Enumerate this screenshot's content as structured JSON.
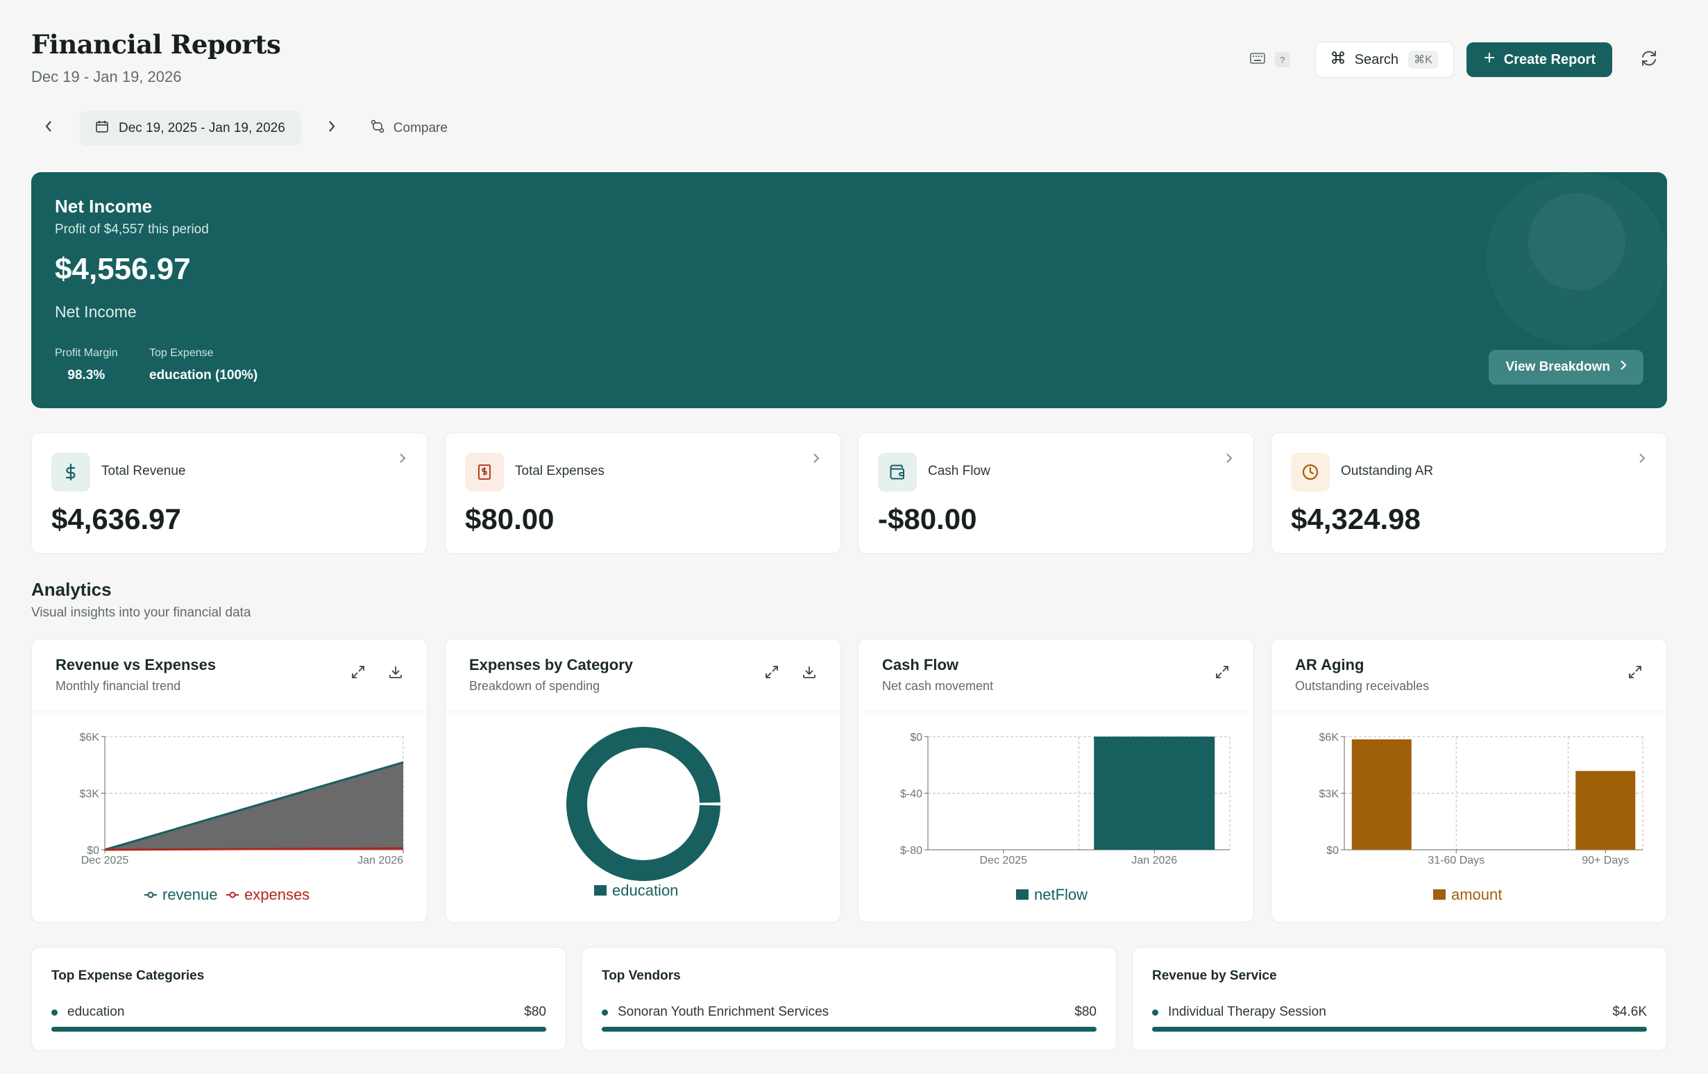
{
  "header": {
    "title": "Financial Reports",
    "subtitle": "Dec 19 - Jan 19, 2026",
    "shortcut_hint": "?",
    "search_label": "Search",
    "search_shortcut": "⌘K",
    "create_label": "Create Report"
  },
  "date_nav": {
    "range": "Dec 19, 2025 - Jan 19, 2026",
    "compare_label": "Compare"
  },
  "hero": {
    "label": "Net Income",
    "subtitle": "Profit of $4,557 this period",
    "value": "$4,556.97",
    "caption": "Net Income",
    "metrics": [
      {
        "label": "Profit Margin",
        "value": "98.3%"
      },
      {
        "label": "Top Expense",
        "value": "education (100%)"
      }
    ],
    "breakdown_label": "View Breakdown"
  },
  "kpis": [
    {
      "label": "Total Revenue",
      "value": "$4,636.97",
      "icon": "dollar-icon",
      "color": "#17605f",
      "bg": "#e5f0ef"
    },
    {
      "label": "Total Expenses",
      "value": "$80.00",
      "icon": "receipt-icon",
      "color": "#b3421f",
      "bg": "#fbece6"
    },
    {
      "label": "Cash Flow",
      "value": "-$80.00",
      "icon": "wallet-icon",
      "color": "#17605f",
      "bg": "#e5f0ef"
    },
    {
      "label": "Outstanding AR",
      "value": "$4,324.98",
      "icon": "clock-icon",
      "color": "#a0600a",
      "bg": "#fbf0e2"
    }
  ],
  "analytics": {
    "title": "Analytics",
    "subtitle": "Visual insights into your financial data"
  },
  "charts": [
    {
      "title": "Revenue vs Expenses",
      "subtitle": "Monthly financial trend"
    },
    {
      "title": "Expenses by Category",
      "subtitle": "Breakdown of spending"
    },
    {
      "title": "Cash Flow",
      "subtitle": "Net cash movement"
    },
    {
      "title": "AR Aging",
      "subtitle": "Outstanding receivables"
    }
  ],
  "chart_data": [
    {
      "type": "area",
      "x": [
        "Dec 2025",
        "Jan 2026"
      ],
      "series": [
        {
          "name": "revenue",
          "values": [
            0,
            4636.97
          ],
          "color": "#17605f"
        },
        {
          "name": "expenses",
          "values": [
            0,
            80
          ],
          "color": "#b3261e"
        }
      ],
      "yticks": [
        "$6K",
        "$3K",
        "$0"
      ],
      "ylim": [
        0,
        6000
      ],
      "grid": true,
      "legend": "bottom"
    },
    {
      "type": "pie",
      "categories": [
        "education"
      ],
      "values": [
        80
      ],
      "color": "#17605f",
      "legend": "bottom"
    },
    {
      "type": "bar",
      "categories": [
        "Dec 2025",
        "Jan 2026"
      ],
      "series": [
        {
          "name": "netFlow",
          "values": [
            0,
            -80
          ],
          "color": "#17605f"
        }
      ],
      "yticks": [
        "$0",
        "$-40",
        "$-80"
      ],
      "ylim": [
        -80,
        0
      ],
      "grid": true,
      "legend": "bottom"
    },
    {
      "type": "bar",
      "categories": [
        "",
        "31-60 Days",
        "",
        "90+ Days"
      ],
      "series": [
        {
          "name": "amount",
          "values": [
            6000,
            0,
            0,
            4324.98
          ],
          "color": "#a0600a"
        }
      ],
      "yticks": [
        "$6K",
        "$3K",
        "$0"
      ],
      "ylim": [
        0,
        6000
      ],
      "grid": true,
      "legend": "bottom"
    }
  ],
  "lists": [
    {
      "title": "Top Expense Categories",
      "name": "education",
      "value": "$80",
      "fill": 1.0
    },
    {
      "title": "Top Vendors",
      "name": "Sonoran Youth Enrichment Services",
      "value": "$80",
      "fill": 1.0
    },
    {
      "title": "Revenue by Service",
      "name": "Individual Therapy Session",
      "value": "$4.6K",
      "fill": 1.0
    }
  ]
}
